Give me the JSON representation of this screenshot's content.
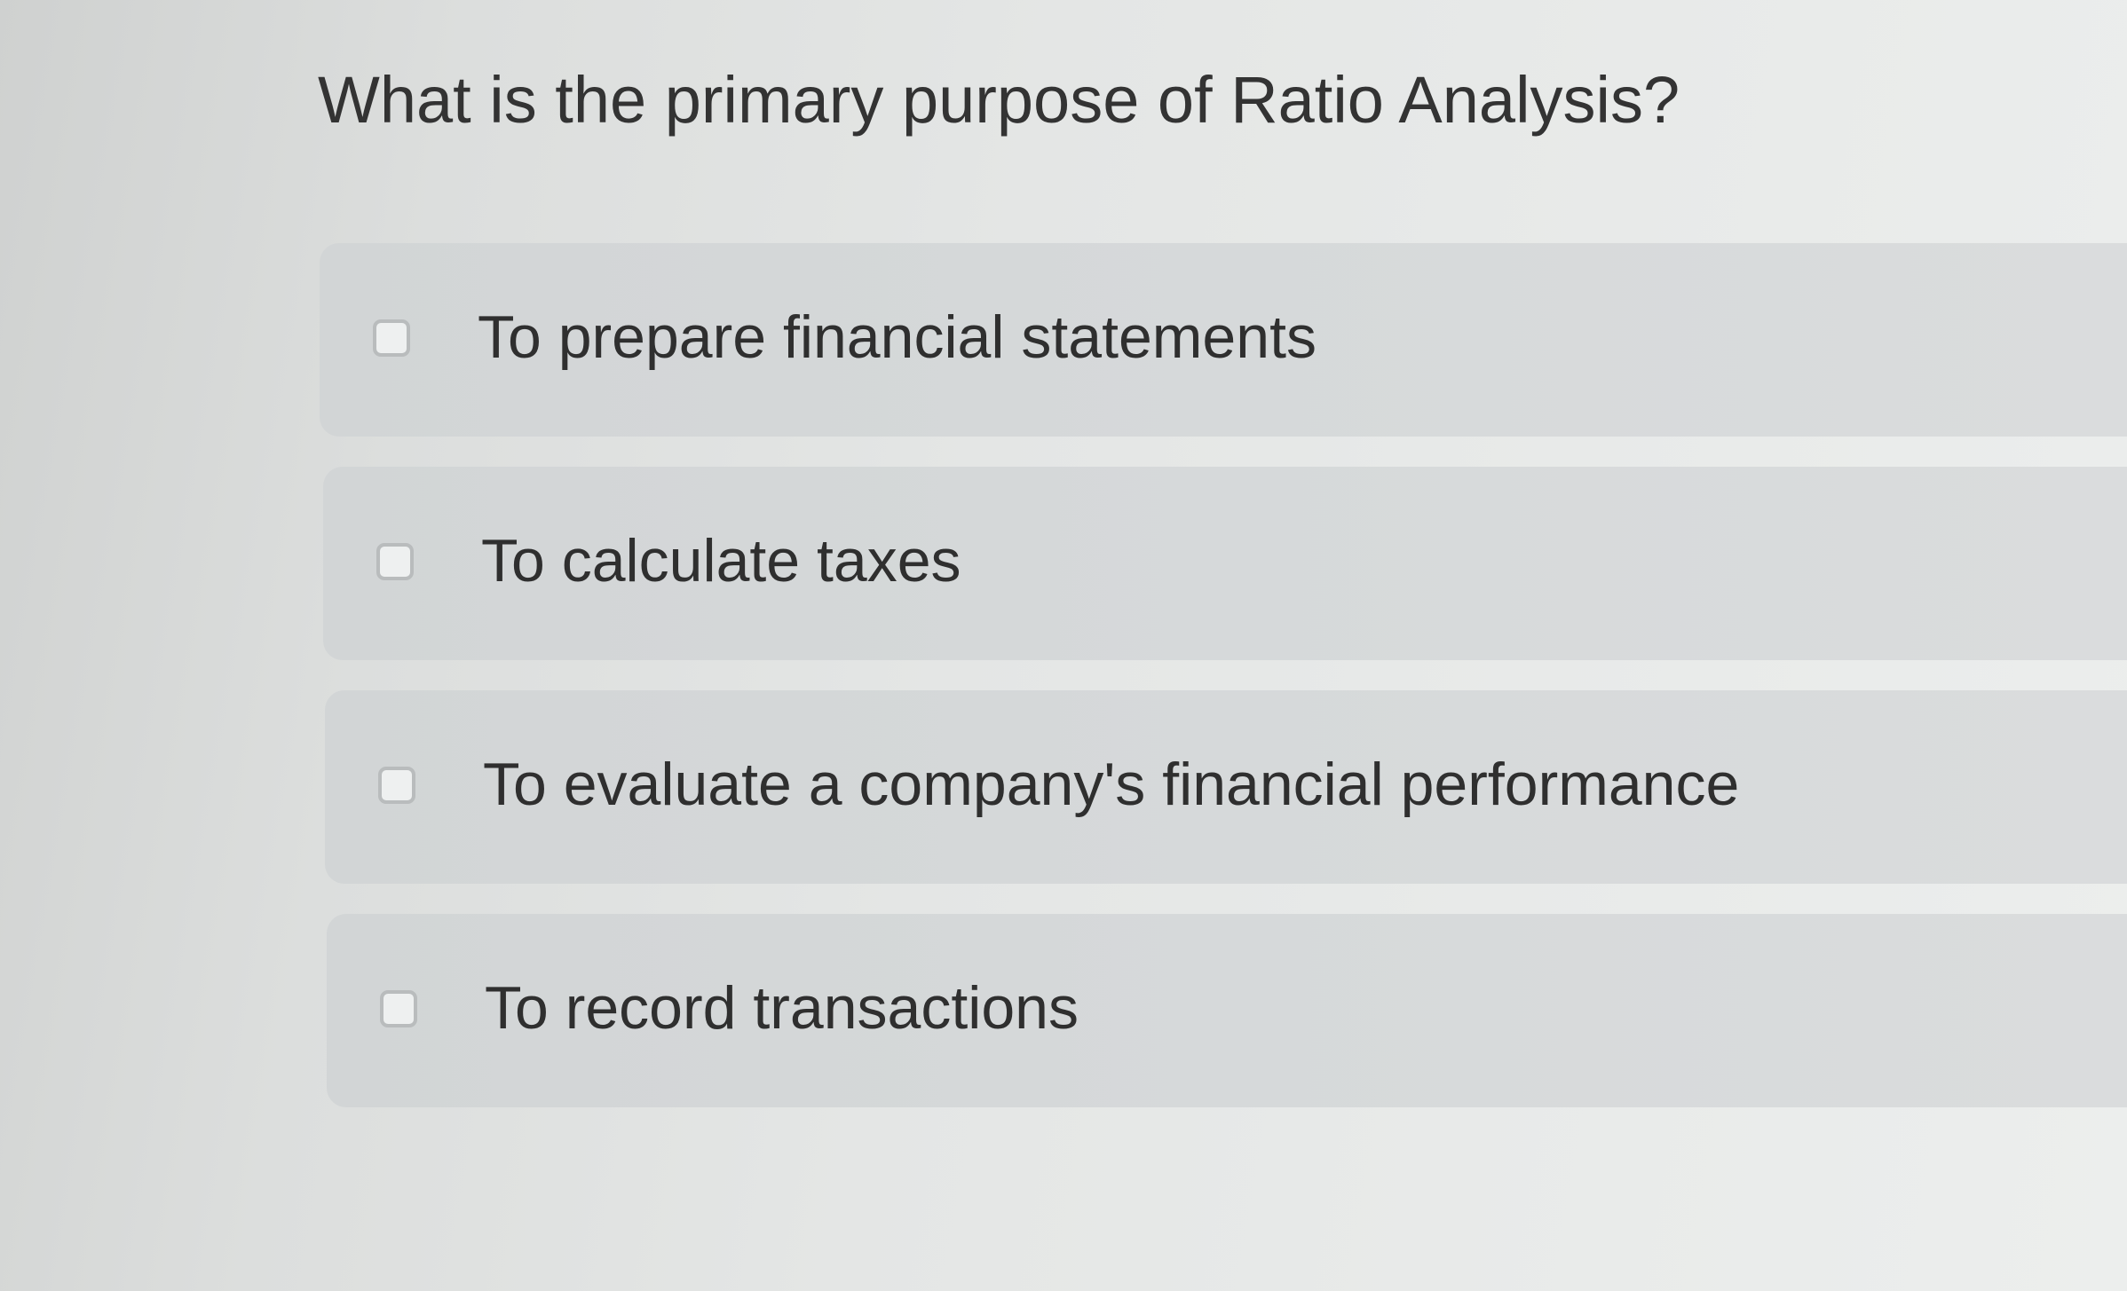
{
  "question": {
    "title": "What is the primary purpose of Ratio Analysis?"
  },
  "options": [
    {
      "label": "To prepare financial statements",
      "checked": false
    },
    {
      "label": "To calculate taxes",
      "checked": false
    },
    {
      "label": "To evaluate a company's financial performance",
      "checked": false
    },
    {
      "label": "To record transactions",
      "checked": false
    }
  ],
  "colors": {
    "text": "#333333",
    "option_background": "#d6d9da",
    "checkbox_border": "#b9bcbd"
  }
}
